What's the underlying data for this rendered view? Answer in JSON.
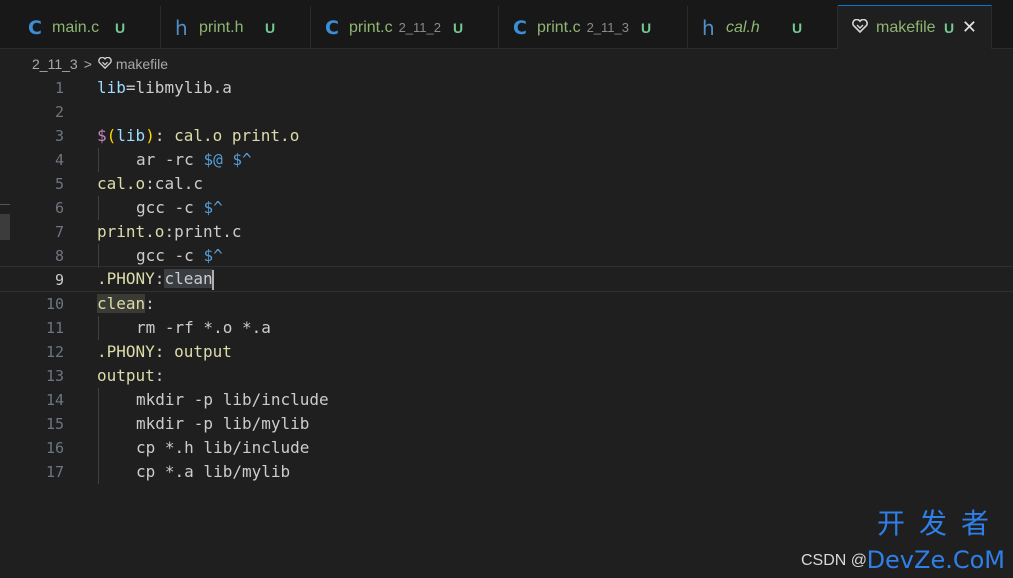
{
  "tabs": [
    {
      "icon": "C",
      "name": "main.c",
      "suffix": "",
      "status": "U",
      "italic": false
    },
    {
      "icon": "h",
      "name": "print.h",
      "suffix": "",
      "status": "U",
      "italic": false
    },
    {
      "icon": "C",
      "name": "print.c",
      "suffix": "2_11_2",
      "status": "U",
      "italic": false
    },
    {
      "icon": "C",
      "name": "print.c",
      "suffix": "2_11_3",
      "status": "U",
      "italic": false
    },
    {
      "icon": "h",
      "name": "cal.h",
      "suffix": "",
      "status": "U",
      "italic": true
    },
    {
      "icon": "heart",
      "name": "makefile",
      "suffix": "",
      "status": "U",
      "italic": false,
      "close": "✕"
    }
  ],
  "breadcrumb": {
    "folder": "2_11_3",
    "separator": ">",
    "file": "makefile"
  },
  "editor": {
    "line_numbers": [
      "1",
      "2",
      "3",
      "4",
      "5",
      "6",
      "7",
      "8",
      "9",
      "10",
      "11",
      "12",
      "13",
      "14",
      "15",
      "16",
      "17"
    ],
    "active_line": "9",
    "lines": {
      "l1": {
        "a": "lib",
        "b": "=libmylib.a"
      },
      "l3": {
        "a": "$",
        "b": "(",
        "c": "lib",
        "d": ")",
        "e": ": cal.o print.o"
      },
      "l4": {
        "a": "ar -rc ",
        "b": "$@",
        "c": " ",
        "d": "$^"
      },
      "l5": {
        "a": "cal.o",
        "b": ":cal.c"
      },
      "l6": {
        "a": "gcc -c ",
        "b": "$^"
      },
      "l7": {
        "a": "print.o",
        "b": ":print.c"
      },
      "l8": {
        "a": "gcc -c ",
        "b": "$^"
      },
      "l9": {
        "a": ".PHONY",
        "b": ":",
        "c": "clean"
      },
      "l10": {
        "a": "clean",
        "b": ":"
      },
      "l11": {
        "a": "rm -rf *.o *.a"
      },
      "l12": {
        "a": ".PHONY",
        "b": ": output"
      },
      "l13": {
        "a": "output",
        "b": ":"
      },
      "l14": {
        "a": "mkdir -p lib/include"
      },
      "l15": {
        "a": "mkdir -p lib/mylib"
      },
      "l16": {
        "a": "cp *.h lib/include"
      },
      "l17": {
        "a": "cp *.a lib/mylib"
      }
    }
  },
  "watermark": {
    "csdn": "CSDN @",
    "cn": "开发者",
    "site": "DevZe.CoM"
  },
  "colors": {
    "accent": "#0078d4",
    "status": "#73c991",
    "watermark": "#2f7fe8"
  }
}
